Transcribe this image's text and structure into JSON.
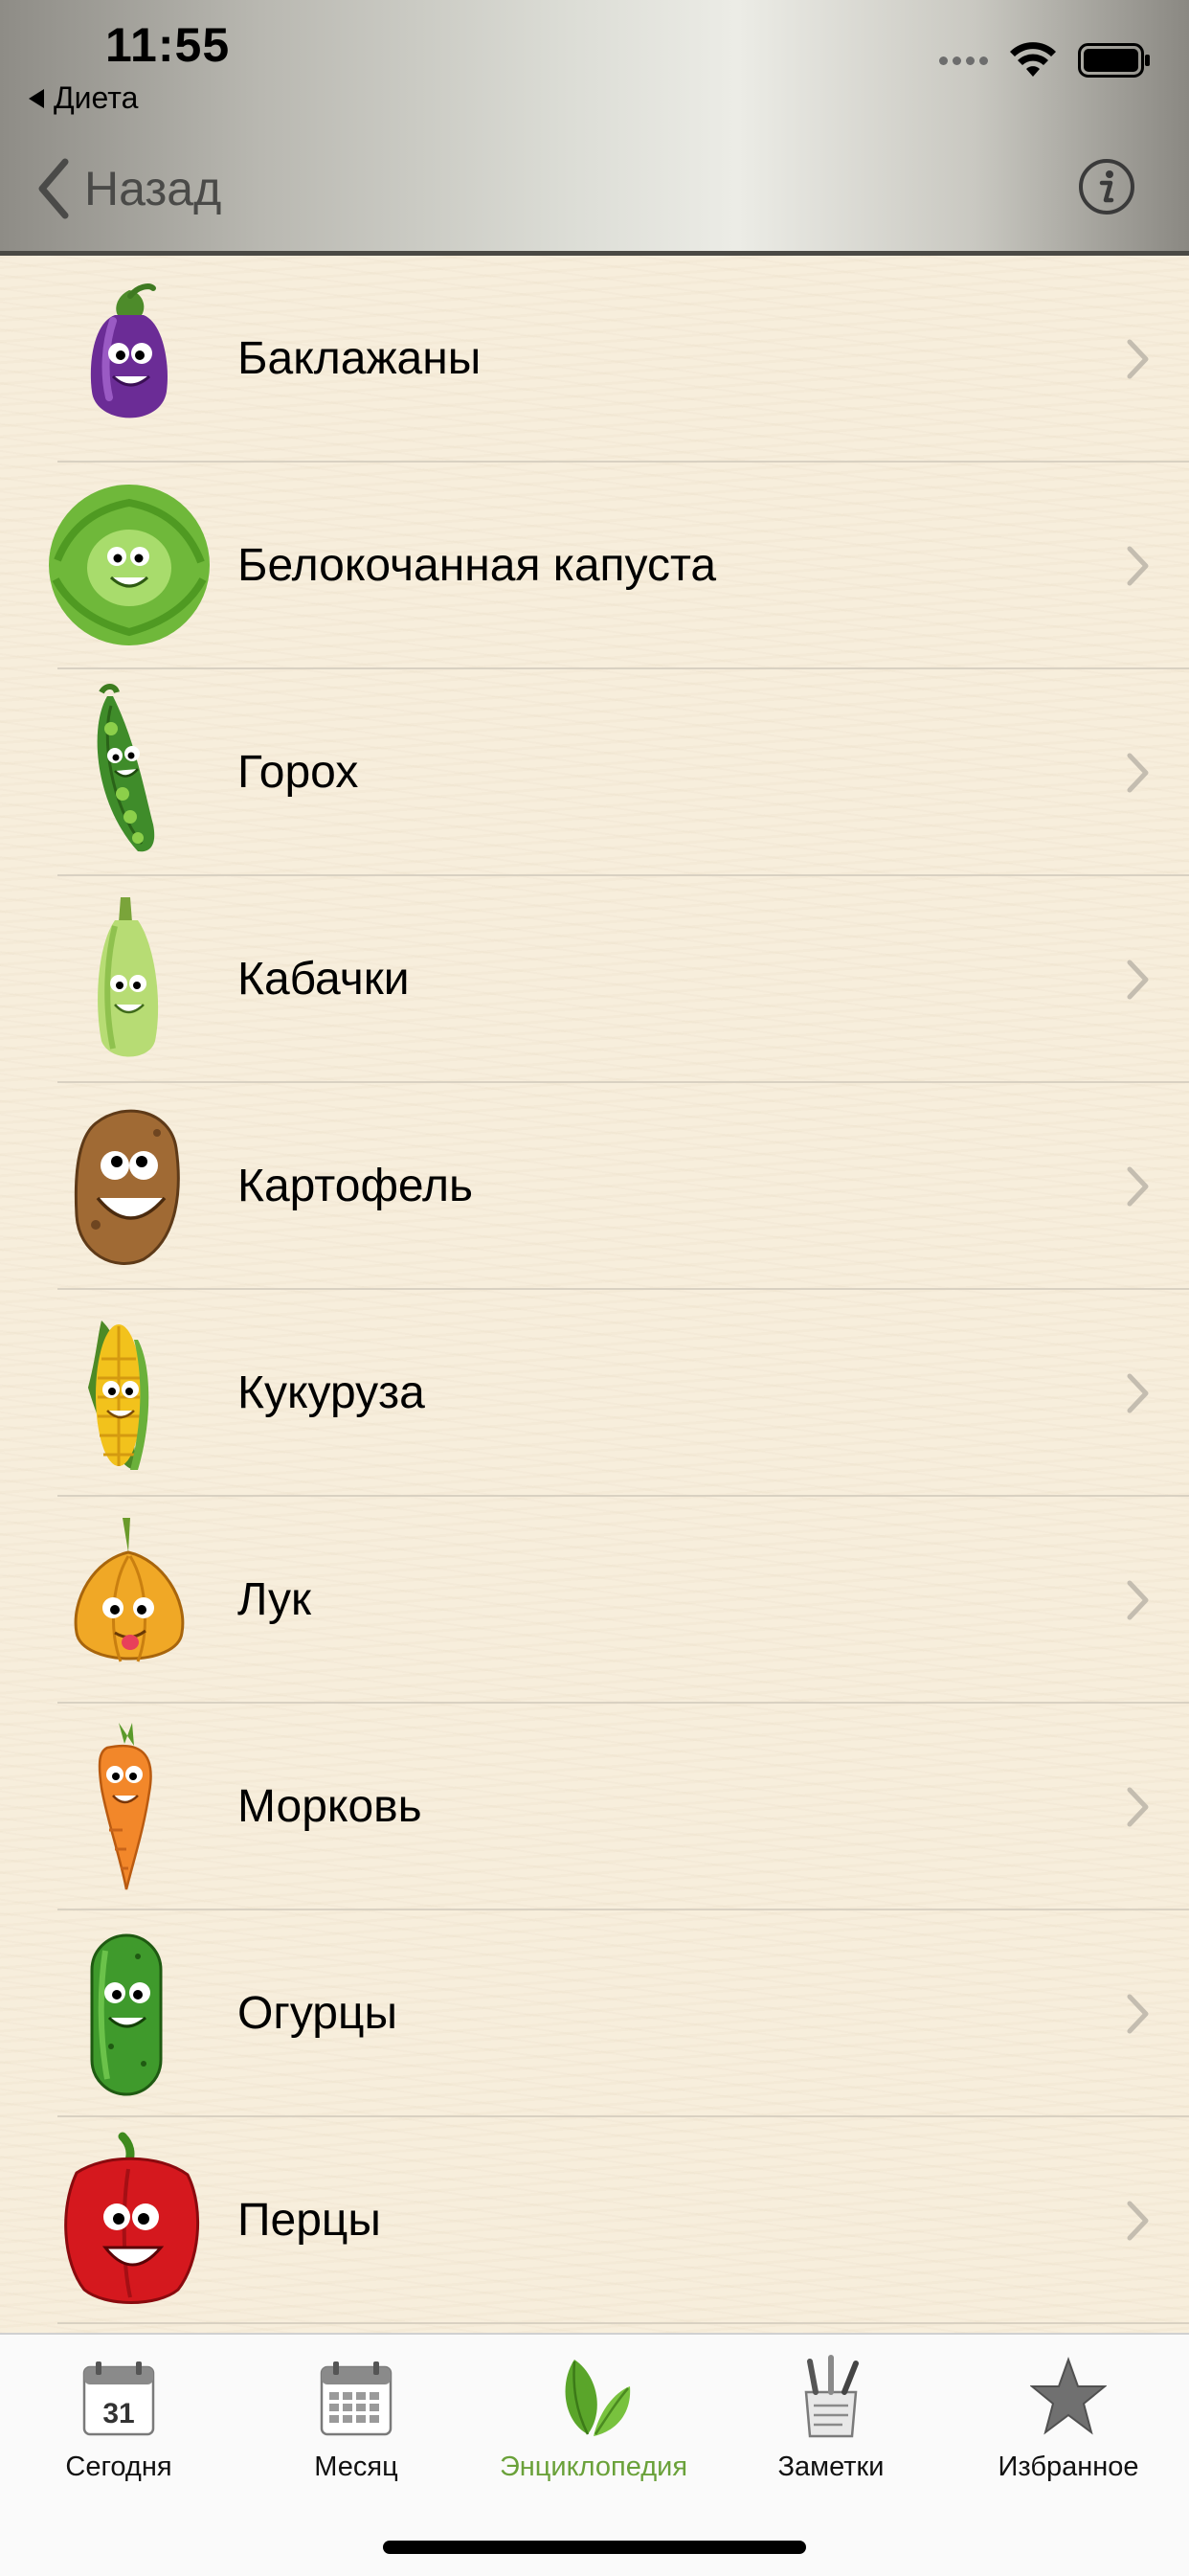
{
  "status_bar": {
    "time": "11:55",
    "back_app": "Диета"
  },
  "nav": {
    "back_label": "Назад",
    "info_icon": "info-icon"
  },
  "list": {
    "items": [
      {
        "label": "Баклажаны",
        "icon": "eggplant-icon"
      },
      {
        "label": "Белокочанная капуста",
        "icon": "cabbage-icon"
      },
      {
        "label": "Горох",
        "icon": "peas-icon"
      },
      {
        "label": "Кабачки",
        "icon": "zucchini-icon"
      },
      {
        "label": "Картофель",
        "icon": "potato-icon"
      },
      {
        "label": "Кукуруза",
        "icon": "corn-icon"
      },
      {
        "label": "Лук",
        "icon": "onion-icon"
      },
      {
        "label": "Морковь",
        "icon": "carrot-icon"
      },
      {
        "label": "Огурцы",
        "icon": "cucumber-icon"
      },
      {
        "label": "Перцы",
        "icon": "pepper-icon"
      }
    ]
  },
  "tabbar": {
    "tabs": [
      {
        "label": "Сегодня",
        "icon": "calendar-day-icon",
        "badge": "31"
      },
      {
        "label": "Месяц",
        "icon": "calendar-month-icon"
      },
      {
        "label": "Энциклопедия",
        "icon": "leaves-icon",
        "active": true
      },
      {
        "label": "Заметки",
        "icon": "notes-icon"
      },
      {
        "label": "Избранное",
        "icon": "star-icon"
      }
    ]
  },
  "colors": {
    "accent": "#6aa13a",
    "list_background": "#f7eedc",
    "separator": "#d9d1c2"
  }
}
